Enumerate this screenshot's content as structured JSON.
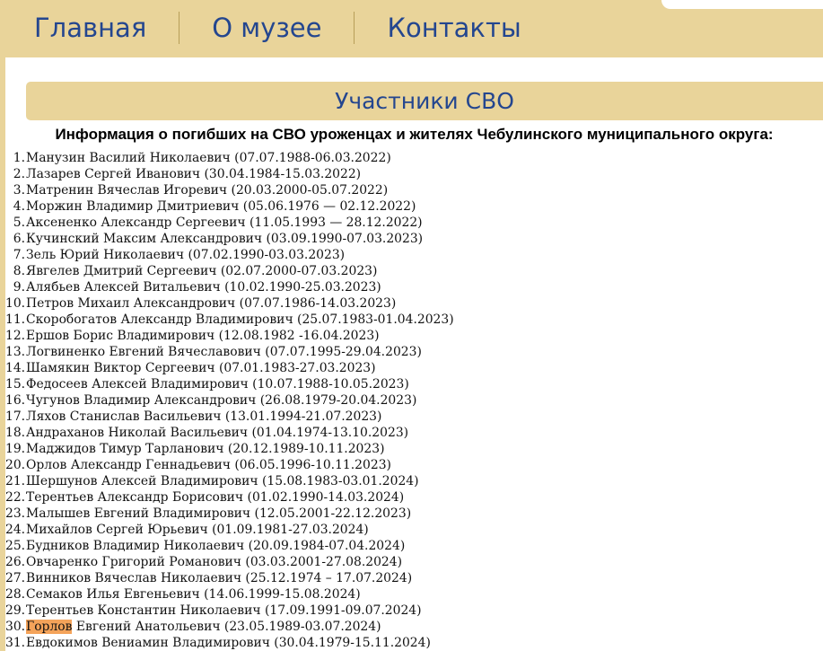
{
  "nav": {
    "items": [
      {
        "label": "Главная"
      },
      {
        "label": "О музее"
      },
      {
        "label": "Контакты"
      }
    ]
  },
  "section": {
    "title": "Участники СВО"
  },
  "info_title": "Информация о погибших на СВО уроженцах и жителях Чебулинского муниципального округа:",
  "list": [
    {
      "num": "1.",
      "text": "Манузин Василий Николаевич (07.07.1988-06.03.2022)"
    },
    {
      "num": "2.",
      "text": "Лазарев Сергей Иванович (30.04.1984-15.03.2022)"
    },
    {
      "num": "3.",
      "text": "Матренин Вячеслав Игоревич (20.03.2000-05.07.2022)"
    },
    {
      "num": "4.",
      "text": "Моржин Владимир Дмитриевич (05.06.1976 — 02.12.2022)"
    },
    {
      "num": "5.",
      "text": "Аксененко Александр Сергеевич (11.05.1993 — 28.12.2022)"
    },
    {
      "num": "6.",
      "text": "Кучинский Максим Александрович (03.09.1990-07.03.2023)"
    },
    {
      "num": "7.",
      "text": "Зель Юрий Николаевич (07.02.1990-03.03.2023)"
    },
    {
      "num": "8.",
      "text": "Явгелев Дмитрий Сергеевич (02.07.2000-07.03.2023)"
    },
    {
      "num": "9.",
      "text": "Алябьев Алексей Витальевич (10.02.1990-25.03.2023)"
    },
    {
      "num": "10.",
      "text": "Петров Михаил Александрович (07.07.1986-14.03.2023)"
    },
    {
      "num": "11.",
      "text": "Скоробогатов Александр Владимирович (25.07.1983-01.04.2023)"
    },
    {
      "num": "12.",
      "text": "Ершов Борис Владимирович (12.08.1982 -16.04.2023)"
    },
    {
      "num": "13.",
      "text": "Логвиненко Евгений Вячеславович (07.07.1995-29.04.2023)"
    },
    {
      "num": "14.",
      "text": "Шамякин Виктор Сергеевич (07.01.1983-27.03.2023)"
    },
    {
      "num": "15.",
      "text": "Федосеев Алексей Владимирович (10.07.1988-10.05.2023)"
    },
    {
      "num": "16.",
      "text": "Чугунов Владимир Александрович (26.08.1979-20.04.2023)"
    },
    {
      "num": "17.",
      "text": "Ляхов Станислав Васильевич (13.01.1994-21.07.2023)"
    },
    {
      "num": "18.",
      "text": "Андраханов Николай Васильевич (01.04.1974-13.10.2023)"
    },
    {
      "num": "19.",
      "text": "Маджидов Тимур Тарланович (20.12.1989-10.11.2023)"
    },
    {
      "num": "20.",
      "text": "Орлов Александр Геннадьевич (06.05.1996-10.11.2023)"
    },
    {
      "num": "21.",
      "text": "Шершунов Алексей Владимирович (15.08.1983-03.01.2024)"
    },
    {
      "num": "22.",
      "text": "Терентьев Александр Борисович (01.02.1990-14.03.2024)"
    },
    {
      "num": "23.",
      "text": "Малышев Евгений Владимирович (12.05.2001-22.12.2023)"
    },
    {
      "num": "24.",
      "text": "Михайлов Сергей Юрьевич (01.09.1981-27.03.2024)"
    },
    {
      "num": "25.",
      "text": "Будников Владимир Николаевич (20.09.1984-07.04.2024)"
    },
    {
      "num": "26.",
      "text": "Овчаренко Григорий Романович (03.03.2001-27.08.2024)"
    },
    {
      "num": "27.",
      "text": "Винников Вячеслав Николаевич (25.12.1974 – 17.07.2024)"
    },
    {
      "num": "28.",
      "text": "Семаков Илья Евгеньевич (14.06.1999-15.08.2024)"
    },
    {
      "num": "29.",
      "text": "Терентьев Константин Николаевич (17.09.1991-09.07.2024)"
    },
    {
      "num": "30.",
      "highlight": "Горлов",
      "text": " Евгений Анатольевич (23.05.1989-03.07.2024)"
    },
    {
      "num": "31.",
      "text": "Евдокимов Вениамин Владимирович (30.04.1979-15.11.2024)"
    }
  ],
  "colors": {
    "brand_beige": "#e9d49a",
    "nav_blue": "#24468f",
    "highlight_orange": "#f4a35a"
  }
}
